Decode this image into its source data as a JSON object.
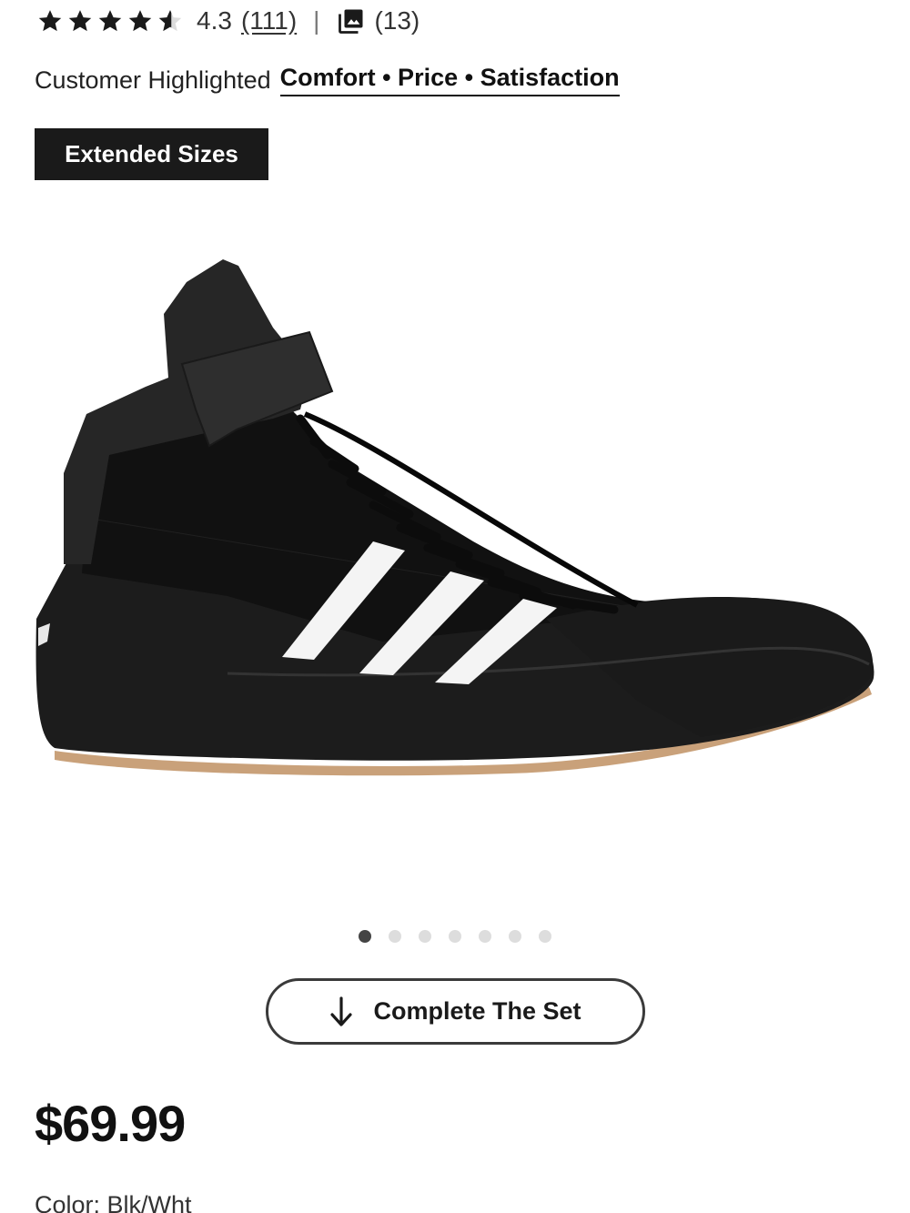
{
  "rating": {
    "value": "4.3",
    "stars_filled_fraction": 0.86,
    "review_count": "(111)",
    "separator": "|",
    "photo_count": "(13)"
  },
  "highlights": {
    "label": "Customer Highlighted",
    "links": "Comfort • Price • Satisfaction"
  },
  "badge": {
    "label": "Extended Sizes"
  },
  "gallery": {
    "total_slides": 7,
    "active_index": 0
  },
  "actions": {
    "complete_set_label": "Complete The Set"
  },
  "price": "$69.99",
  "color_row": "Color: Blk/Wht",
  "icons": {
    "star": "star-icon",
    "photos": "photo-gallery-icon",
    "arrow": "arrow-down-icon"
  },
  "colors": {
    "text": "#1a1a1a",
    "badge_bg": "#1a1a1a",
    "dot_active": "#444444",
    "dot_inactive": "#dddddd",
    "border": "#3a3a3a",
    "sole_gum": "#c9a17a"
  }
}
